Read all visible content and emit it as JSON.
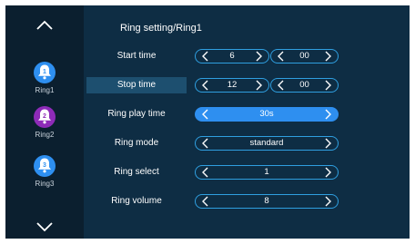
{
  "sidebar": {
    "up_icon": "chevron-up-icon",
    "down_icon": "chevron-down-icon",
    "items": [
      {
        "label": "Ring1",
        "number": "1",
        "color": "#2e8ff0",
        "icon": "bell-icon"
      },
      {
        "label": "Ring2",
        "number": "2",
        "color": "#8e2bb8",
        "icon": "bell-icon"
      },
      {
        "label": "Ring3",
        "number": "3",
        "color": "#2e8ff0",
        "icon": "bell-icon"
      }
    ]
  },
  "page": {
    "breadcrumb": "Ring setting/Ring1"
  },
  "rows": {
    "start_time": {
      "label": "Start time",
      "hour": "6",
      "minute": "00"
    },
    "stop_time": {
      "label": "Stop time",
      "hour": "12",
      "minute": "00"
    },
    "ring_play_time": {
      "label": "Ring play time",
      "value": "30s"
    },
    "ring_mode": {
      "label": "Ring mode",
      "value": "standard"
    },
    "ring_select": {
      "label": "Ring select",
      "value": "1"
    },
    "ring_volume": {
      "label": "Ring volume",
      "value": "8"
    }
  },
  "colors": {
    "accent": "#2e8ff0",
    "selected_label_bg": "#1d4f6f",
    "background": "#0e2d44"
  }
}
